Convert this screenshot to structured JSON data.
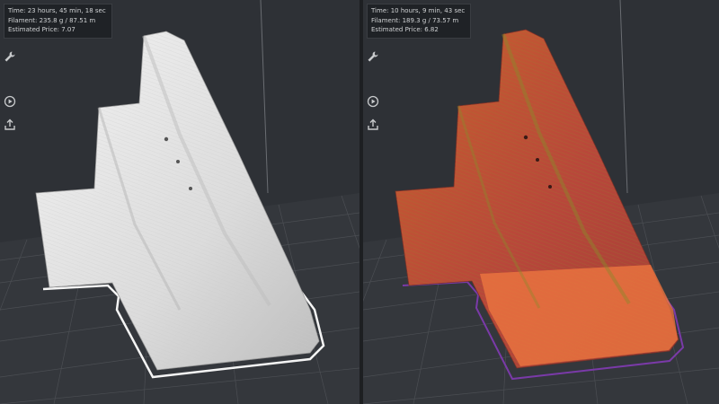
{
  "views": [
    {
      "id": "left",
      "time": "Time: 23 hours, 45 min, 18 sec",
      "filament": "Filament: 235.8 g / 87.51 m",
      "price": "Estimated Price: 7.07",
      "model_color": "#e9e9e9"
    },
    {
      "id": "right",
      "time": "Time: 10 hours, 9 min, 43 sec",
      "filament": "Filament: 189.3 g / 73.57 m",
      "price": "Estimated Price: 6.82",
      "model_color": "#c65236"
    }
  ],
  "toolbar_icons": [
    "wrench-icon",
    "play-icon",
    "export-icon"
  ],
  "colors": {
    "background": "#2e3136",
    "grid": "#4a4d52",
    "accent_orange": "#f07840",
    "skirt_purple": "#7a3aa8"
  }
}
